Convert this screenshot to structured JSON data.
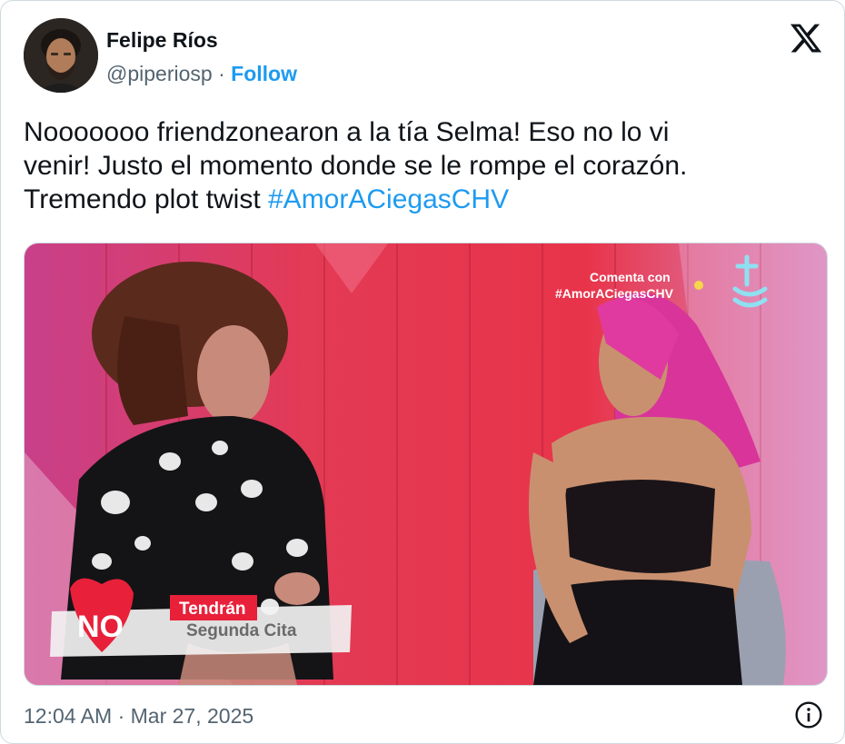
{
  "author": {
    "display_name": "Felipe Ríos",
    "handle": "@piperiosp",
    "separator": "·",
    "follow_label": "Follow"
  },
  "tweet": {
    "text_line1": "Nooooooo friendzonearon a la tía Selma! Eso no lo vi",
    "text_line2": "venir! Justo el momento donde se le rompe el corazón.",
    "text_line3_prefix": "Tremendo plot twist ",
    "hashtag": "#AmorACiegasCHV"
  },
  "media": {
    "overlay_comment_label": "Comenta con",
    "overlay_comment_hashtag": "#AmorACiegasCHV",
    "channel_logo": "CHV",
    "lower_third_no": "NO",
    "lower_third_line1": "Tendrán",
    "lower_third_line2": "Segunda Cita"
  },
  "footer": {
    "timestamp": "12:04 AM · Mar 27, 2025"
  },
  "icons": {
    "platform_logo": "x-logo-icon",
    "info": "info-icon"
  },
  "colors": {
    "link": "#1d9bf0",
    "text_primary": "#0f1419",
    "text_secondary": "#536471",
    "background_red": "#e8344a"
  }
}
